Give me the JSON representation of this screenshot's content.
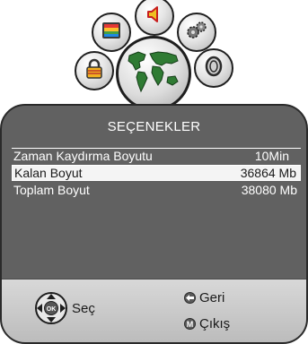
{
  "menu": {
    "title": "SEÇENEKLER",
    "rows": [
      {
        "label": "Zaman Kaydırma Boyutu",
        "value": "10Min"
      },
      {
        "label": "Kalan Boyut",
        "value": "36864 Mb"
      },
      {
        "label": "Toplam Boyut",
        "value": "38080 Mb"
      }
    ],
    "selected_index": 1
  },
  "footer": {
    "select_label": "Seç",
    "ok_glyph": "OK",
    "back_label": "Geri",
    "exit_label": "Çıkış",
    "exit_glyph": "M"
  },
  "icons": [
    "image-icon",
    "sound-icon",
    "settings-gears-icon",
    "lock-icon",
    "world-map-icon",
    "disc-icon"
  ],
  "colors": {
    "panel": "#616161",
    "footer": "#c8c8c8",
    "selected_row": "#f4f4f4",
    "map_green": "#2f7b33"
  }
}
